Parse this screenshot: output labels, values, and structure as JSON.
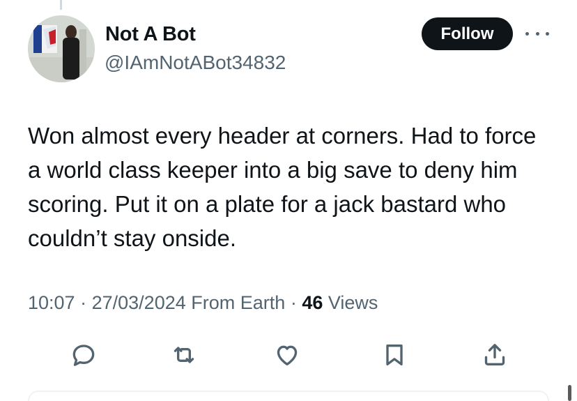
{
  "author": {
    "display_name": "Not A Bot",
    "handle": "@IAmNotABot34832",
    "avatar_icon": "profile-photo"
  },
  "follow_button": {
    "label": "Follow"
  },
  "more_button": {
    "icon": "ellipsis-icon"
  },
  "tweet": {
    "text": "Won almost every header at corners. Had to force a world class keeper into a big save to deny him scoring. Put it on a plate for a jack bastard who couldn’t stay onside."
  },
  "meta": {
    "time": "10:07",
    "separator": "·",
    "date": "27/03/2024",
    "source": "From Earth",
    "views_count": "46",
    "views_label": "Views"
  },
  "actions": [
    {
      "name": "reply",
      "icon": "reply-icon"
    },
    {
      "name": "retweet",
      "icon": "retweet-icon"
    },
    {
      "name": "like",
      "icon": "heart-icon"
    },
    {
      "name": "bookmark",
      "icon": "bookmark-icon"
    },
    {
      "name": "share",
      "icon": "share-icon"
    }
  ],
  "colors": {
    "text_primary": "#0f1419",
    "text_secondary": "#536471",
    "button_bg": "#0f1419",
    "button_text": "#ffffff"
  }
}
